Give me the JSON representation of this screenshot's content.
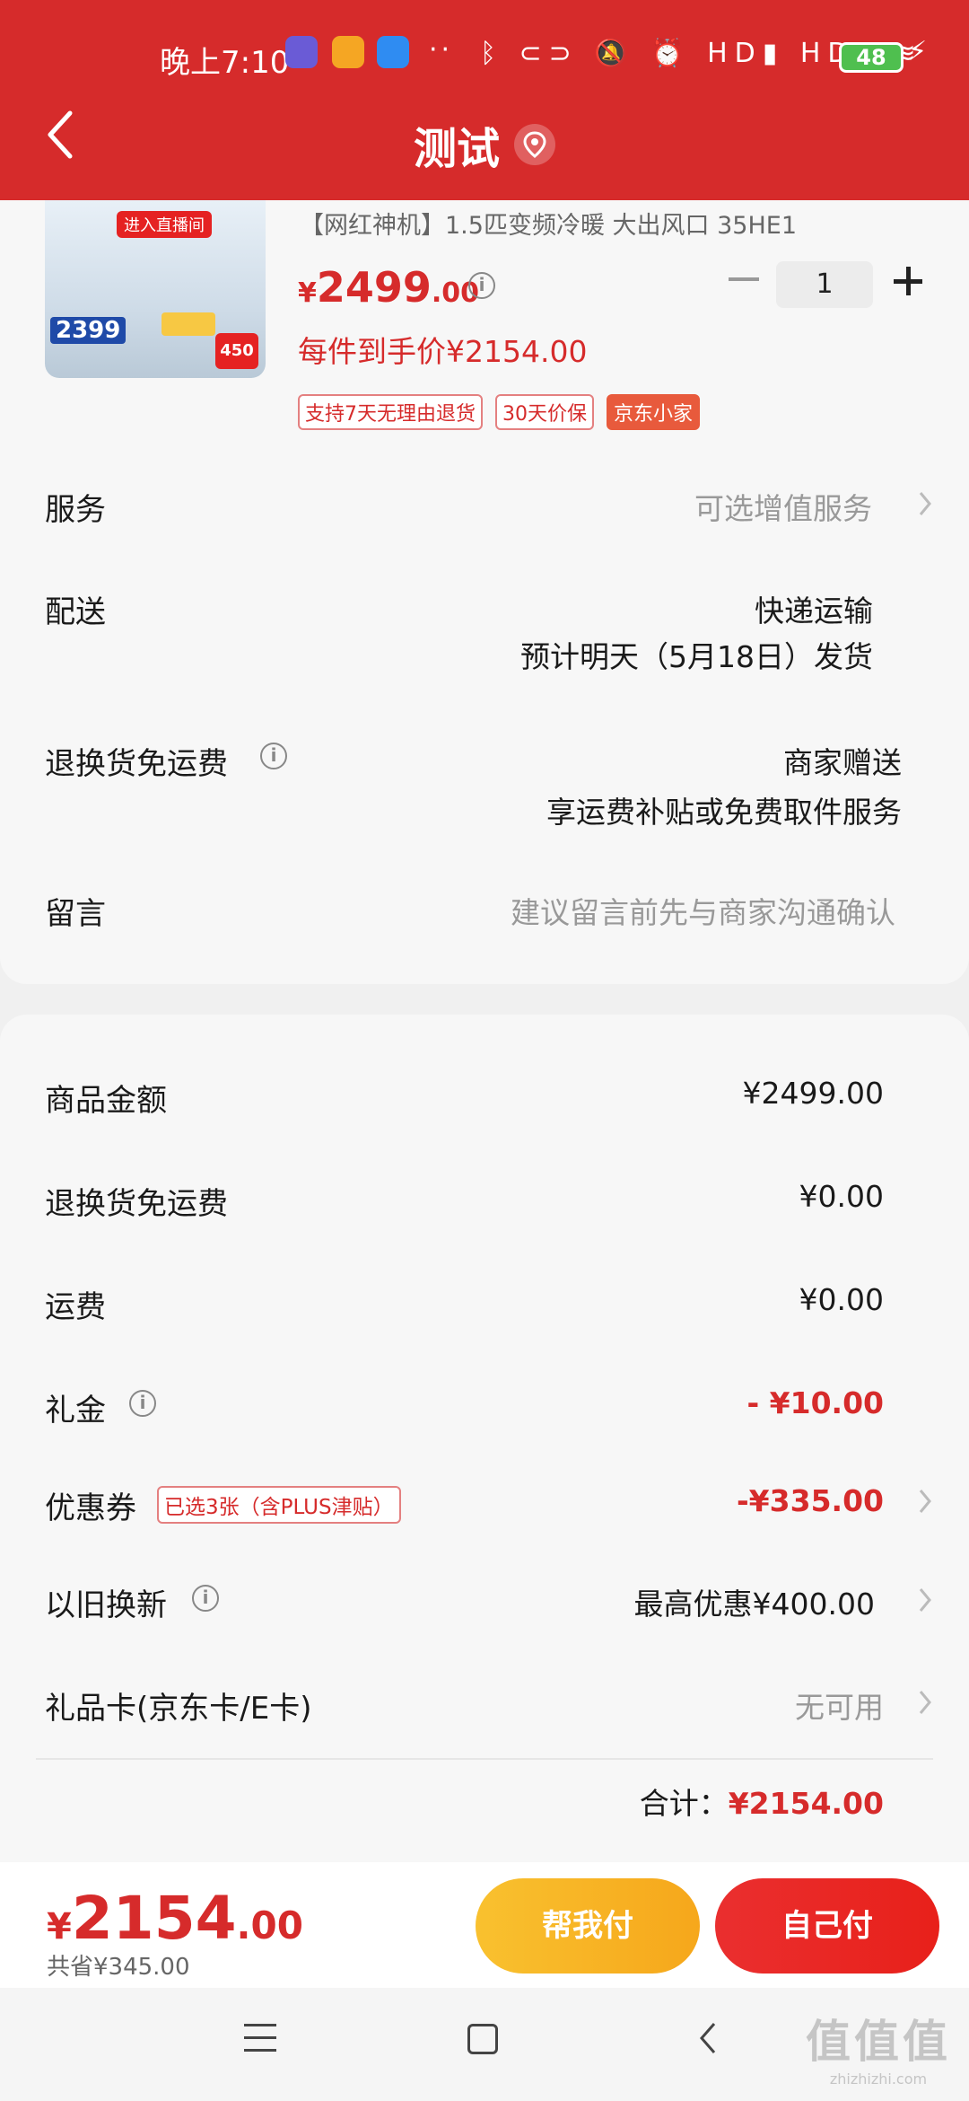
{
  "status_bar": {
    "time": "晚上7:10",
    "dots": "··",
    "network": "ᛒ ⊂⊃ 🔕 ⏰ HD▮ HD▮ ≋",
    "battery": "48",
    "colors": {
      "app1": "#6a5bd6",
      "app2": "#f5a623",
      "app3": "#2f8cf2"
    }
  },
  "header": {
    "title": "测试",
    "back_icon": "chevron-left-icon",
    "location_icon": "location-pin-icon",
    "color": "#d62b2b"
  },
  "product": {
    "thumb_tags": {
      "live": "进入直播间",
      "price": "2399",
      "badge": "450"
    },
    "title": "【网红神机】1.5匹变频冷暖 大出风口 35HE1",
    "price_symbol": "¥",
    "price_int": "2499",
    "price_dec": ".00",
    "quantity": "1",
    "unit_price": "每件到手价¥2154.00",
    "badges": [
      "支持7天无理由退货",
      "30天价保",
      "京东小家"
    ]
  },
  "details": {
    "service_label": "服务",
    "service_value": "可选增值服务",
    "delivery_label": "配送",
    "delivery_line1": "快递运输",
    "delivery_line2": "预计明天（5月18日）发货",
    "return_label": "退换货免运费",
    "return_line1": "商家赠送",
    "return_line2": "享运费补贴或免费取件服务",
    "message_label": "留言",
    "message_placeholder": "建议留言前先与商家沟通确认"
  },
  "summary": {
    "goods_label": "商品金额",
    "goods_value": "¥2499.00",
    "return_fee_label": "退换货免运费",
    "return_fee_value": "¥0.00",
    "shipping_label": "运费",
    "shipping_value": "¥0.00",
    "gift_label": "礼金",
    "gift_value": "- ¥10.00",
    "coupon_label": "优惠券",
    "coupon_badge": "已选3张（含PLUS津贴）",
    "coupon_value": "-¥335.00",
    "tradein_label": "以旧换新",
    "tradein_value": "最高优惠¥400.00",
    "giftcard_label": "礼品卡(京东卡/E卡)",
    "giftcard_value": "无可用",
    "total_label": "合计：",
    "total_value": "¥2154.00"
  },
  "bottom": {
    "pay_symbol": "¥",
    "pay_int": "2154",
    "pay_dec": ".00",
    "saved": "共省¥345.00",
    "help_pay": "帮我付",
    "self_pay": "自己付"
  },
  "watermark": {
    "big": "值值值",
    "small": "zhizhizhi.com"
  }
}
